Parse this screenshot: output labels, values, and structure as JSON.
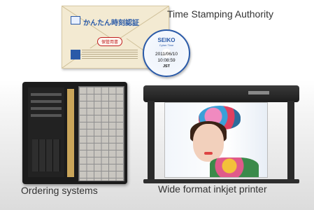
{
  "labels": {
    "tsa": "Time Stamping Authority",
    "ordering": "Ordering systems",
    "printer": "Wide format inkjet printer"
  },
  "envelope": {
    "title": "かんたん時刻認証",
    "stamp": "保管用書"
  },
  "disc": {
    "brand": "SEIKO",
    "sub": "Cyber Time",
    "date": "2011/06/10",
    "time": "10:08:59",
    "tz": "JST"
  },
  "colors": {
    "accent": "#2a5aa8",
    "label_text": "#333333"
  }
}
